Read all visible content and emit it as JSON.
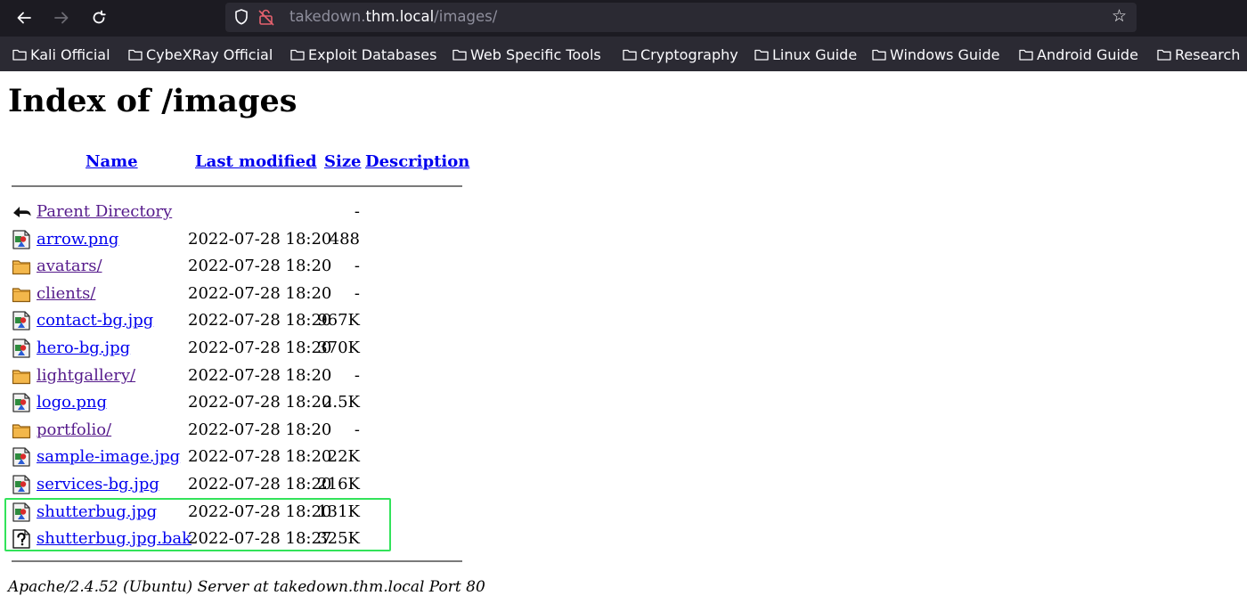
{
  "browser": {
    "url_prefix": "takedown.",
    "url_host": "thm.local",
    "url_path": "/images/",
    "bookmarks": [
      "Kali Official",
      "CybeXRay Official",
      "Exploit Databases",
      "Web Specific Tools",
      "Cryptography",
      "Linux Guide",
      "Windows Guide",
      "Android Guide",
      "Research"
    ]
  },
  "page": {
    "heading": "Index of /images",
    "columns": {
      "name": "Name",
      "last_modified": "Last modified",
      "size": "Size",
      "description": "Description"
    },
    "entries": [
      {
        "icon": "back-icon",
        "name": "Parent Directory",
        "modified": "",
        "size": "-"
      },
      {
        "icon": "image-icon",
        "name": "arrow.png",
        "modified": "2022-07-28 18:20",
        "size": "488"
      },
      {
        "icon": "folder-icon",
        "name": "avatars/",
        "modified": "2022-07-28 18:20",
        "size": "-"
      },
      {
        "icon": "folder-icon",
        "name": "clients/",
        "modified": "2022-07-28 18:20",
        "size": "-"
      },
      {
        "icon": "image-icon",
        "name": "contact-bg.jpg",
        "modified": "2022-07-28 18:20",
        "size": "967K"
      },
      {
        "icon": "image-icon",
        "name": "hero-bg.jpg",
        "modified": "2022-07-28 18:20",
        "size": "370K"
      },
      {
        "icon": "folder-icon",
        "name": "lightgallery/",
        "modified": "2022-07-28 18:20",
        "size": "-"
      },
      {
        "icon": "image-icon",
        "name": "logo.png",
        "modified": "2022-07-28 18:20",
        "size": "2.5K"
      },
      {
        "icon": "folder-icon",
        "name": "portfolio/",
        "modified": "2022-07-28 18:20",
        "size": "-"
      },
      {
        "icon": "image-icon",
        "name": "sample-image.jpg",
        "modified": "2022-07-28 18:20",
        "size": "22K"
      },
      {
        "icon": "image-icon",
        "name": "services-bg.jpg",
        "modified": "2022-07-28 18:20",
        "size": "216K"
      },
      {
        "icon": "image-icon",
        "name": "shutterbug.jpg",
        "modified": "2022-07-28 18:20",
        "size": "131K"
      },
      {
        "icon": "unknown-file-icon",
        "name": "shutterbug.jpg.bak",
        "modified": "2022-07-28 18:27",
        "size": "325K"
      }
    ],
    "footer": "Apache/2.4.52 (Ubuntu) Server at takedown.thm.local Port 80",
    "highlight_color": "#32e35a"
  }
}
